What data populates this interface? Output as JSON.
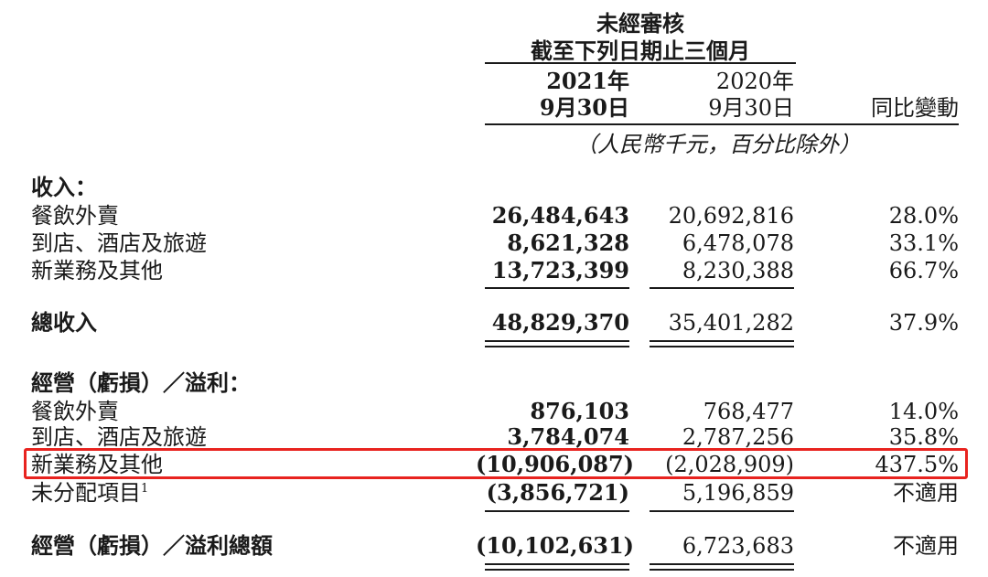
{
  "header": {
    "audit_status": "未經審核",
    "period": "截至下列日期止三個月",
    "col1_year": "2021年",
    "col1_date": "9月30日",
    "col2_year": "2020年",
    "col2_date": "9月30日",
    "col3_label": "同比變動",
    "unit_note": "（人民幣千元，百分比除外）"
  },
  "revenue": {
    "title": "收入：",
    "rows": [
      {
        "label": "餐飲外賣",
        "y2021": "26,484,643",
        "y2020": "20,692,816",
        "change": "28.0%"
      },
      {
        "label": "到店、酒店及旅遊",
        "y2021": "8,621,328",
        "y2020": "6,478,078",
        "change": "33.1%"
      },
      {
        "label": "新業務及其他",
        "y2021": "13,723,399",
        "y2020": "8,230,388",
        "change": "66.7%"
      }
    ],
    "total": {
      "label": "總收入",
      "y2021": "48,829,370",
      "y2020": "35,401,282",
      "change": "37.9%"
    }
  },
  "operating": {
    "title": "經營（虧損）／溢利：",
    "rows": [
      {
        "label": "餐飲外賣",
        "y2021": "876,103",
        "y2020": "768,477",
        "change": "14.0%"
      },
      {
        "label": "到店、酒店及旅遊",
        "y2021": "3,784,074",
        "y2020": "2,787,256",
        "change": "35.8%"
      },
      {
        "label": "新業務及其他",
        "y2021": "(10,906,087)",
        "y2020": "(2,028,909)",
        "change": "437.5%"
      },
      {
        "label": "未分配項目",
        "footnote": "1",
        "y2021": "(3,856,721)",
        "y2020": "5,196,859",
        "change": "不適用"
      }
    ],
    "total": {
      "label": "經營（虧損）／溢利總額",
      "y2021": "(10,102,631)",
      "y2020": "6,723,683",
      "change": "不適用"
    }
  },
  "colors": {
    "highlight": "#e8231f",
    "text": "#1a1a1a"
  }
}
